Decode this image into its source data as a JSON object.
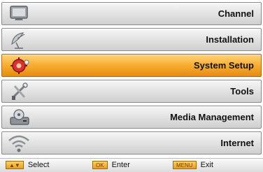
{
  "menu": {
    "items": [
      {
        "label": "Channel",
        "icon": "tv-screen-icon"
      },
      {
        "label": "Installation",
        "icon": "satellite-dish-icon"
      },
      {
        "label": "System Setup",
        "icon": "settings-gear-icon",
        "selected": true
      },
      {
        "label": "Tools",
        "icon": "tools-icon"
      },
      {
        "label": "Media Management",
        "icon": "media-drive-icon"
      },
      {
        "label": "Internet",
        "icon": "wifi-icon"
      }
    ]
  },
  "footer": {
    "select": {
      "key": "▲▼",
      "label": "Select"
    },
    "enter": {
      "key": "OK",
      "label": "Enter"
    },
    "exit": {
      "key": "MENU",
      "label": "Exit"
    }
  },
  "colors": {
    "selected_row": "#f7ad30",
    "row": "#e4e4e4",
    "text": "#111111"
  }
}
